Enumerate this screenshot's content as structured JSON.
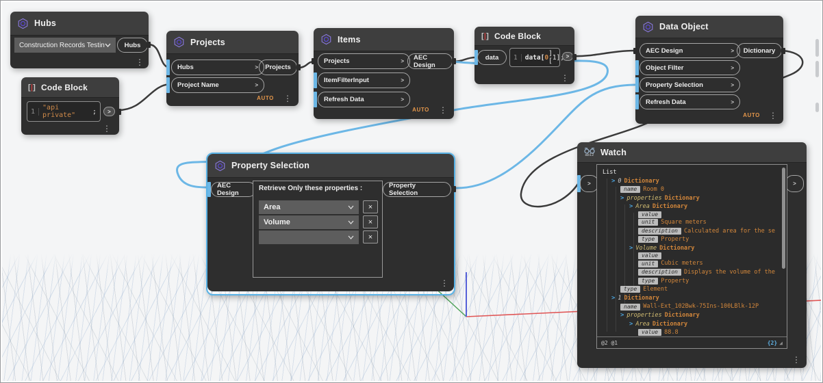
{
  "app": {
    "name": "Dynamo graph canvas"
  },
  "colors": {
    "canvas_bg": "#f4f5f6",
    "node_header": "#3e3e3e",
    "node_body": "#2e2e2e",
    "selected_border": "#58b2e6",
    "wire_dark": "#3b3b3b",
    "wire_selected": "#6cb7e6",
    "default_port_marker": "#6cb7e6",
    "auto_orange": "#e2954a",
    "dict_orange": "#d3873b",
    "key_yellow": "#d3bd72",
    "chevron_blue": "#4ba3dc",
    "axis_x": "#e05555",
    "axis_y": "#5560d8",
    "axis_z": "#4aa055"
  },
  "icons": {
    "more": "⋮",
    "port_chevron": ">",
    "close": "×",
    "resize": "◢",
    "bracket_open": "[",
    "bracket_bar": "|",
    "bracket_close": "]",
    "watch_text": "ab12"
  },
  "nodes": {
    "hubs": {
      "title": "Hubs",
      "dropdown_value": "Construction Records Testing",
      "output": "Hubs"
    },
    "code_block_1": {
      "title": "Code Block",
      "line_no": "1",
      "code_string": "\"api private\"",
      "code_suffix": ";",
      "output": ">"
    },
    "projects": {
      "title": "Projects",
      "inputs": [
        "Hubs",
        "Project Name"
      ],
      "output": "Projects",
      "lacing": "AUTO"
    },
    "items": {
      "title": "Items",
      "inputs": [
        "Projects",
        "ItemFilterInput",
        "Refresh Data"
      ],
      "output": "AEC Design",
      "lacing": "AUTO"
    },
    "code_block_2": {
      "title": "Code Block",
      "input": "data",
      "line_no": "1",
      "code_head": "data[",
      "code_index0": "0",
      "code_mid": "][",
      "code_index1": "1",
      "code_tail": "];",
      "output": ">"
    },
    "data_object": {
      "title": "Data Object",
      "inputs": [
        "AEC Design",
        "Object Filter",
        "Property Selection",
        "Refresh Data"
      ],
      "output": "Dictionary",
      "lacing": "AUTO"
    },
    "property_selection": {
      "title": "Property Selection",
      "input": "AEC Design",
      "output": "Property Selection",
      "panel_label": "Retrieve Only these properties :",
      "dropdowns": [
        "Area",
        "Volume",
        ""
      ]
    },
    "watch": {
      "title": "Watch",
      "input_label": ">",
      "output_label": ">",
      "footer_left": "@2 @1",
      "footer_right": "{2}",
      "rows": [
        {
          "i": 0,
          "t": "List",
          "s": "plain"
        },
        {
          "i": 1,
          "c": 1,
          "n": "0",
          "t": "Dictionary",
          "s": "dict"
        },
        {
          "i": 2,
          "p": "name",
          "t": "Room 0",
          "s": "val"
        },
        {
          "i": 2,
          "c": 1,
          "k": "properties",
          "t": "Dictionary",
          "s": "dict"
        },
        {
          "i": 3,
          "c": 1,
          "k": "Area",
          "t": "Dictionary",
          "s": "dict"
        },
        {
          "i": 4,
          "p": "value"
        },
        {
          "i": 4,
          "p": "unit",
          "t": "Square meters",
          "s": "val"
        },
        {
          "i": 4,
          "p": "description",
          "t": "Calculated area for the se",
          "s": "val"
        },
        {
          "i": 4,
          "p": "type",
          "t": "Property",
          "s": "val"
        },
        {
          "i": 3,
          "c": 1,
          "k": "Volume",
          "t": "Dictionary",
          "s": "dict"
        },
        {
          "i": 4,
          "p": "value"
        },
        {
          "i": 4,
          "p": "unit",
          "t": "Cubic meters",
          "s": "val"
        },
        {
          "i": 4,
          "p": "description",
          "t": "Displays the volume of the",
          "s": "val"
        },
        {
          "i": 4,
          "p": "type",
          "t": "Property",
          "s": "val"
        },
        {
          "i": 2,
          "p": "type",
          "t": "Element",
          "s": "val"
        },
        {
          "i": 1,
          "c": 1,
          "n": "1",
          "t": "Dictionary",
          "s": "dict"
        },
        {
          "i": 2,
          "p": "name",
          "t": "Wall-Ext_102Bwk-75Ins-100LBlk-12P",
          "s": "val"
        },
        {
          "i": 2,
          "c": 1,
          "k": "properties",
          "t": "Dictionary",
          "s": "dict"
        },
        {
          "i": 3,
          "c": 1,
          "k": "Area",
          "t": "Dictionary",
          "s": "dict"
        },
        {
          "i": 4,
          "p": "value",
          "t": "88.8",
          "s": "val"
        }
      ]
    }
  }
}
